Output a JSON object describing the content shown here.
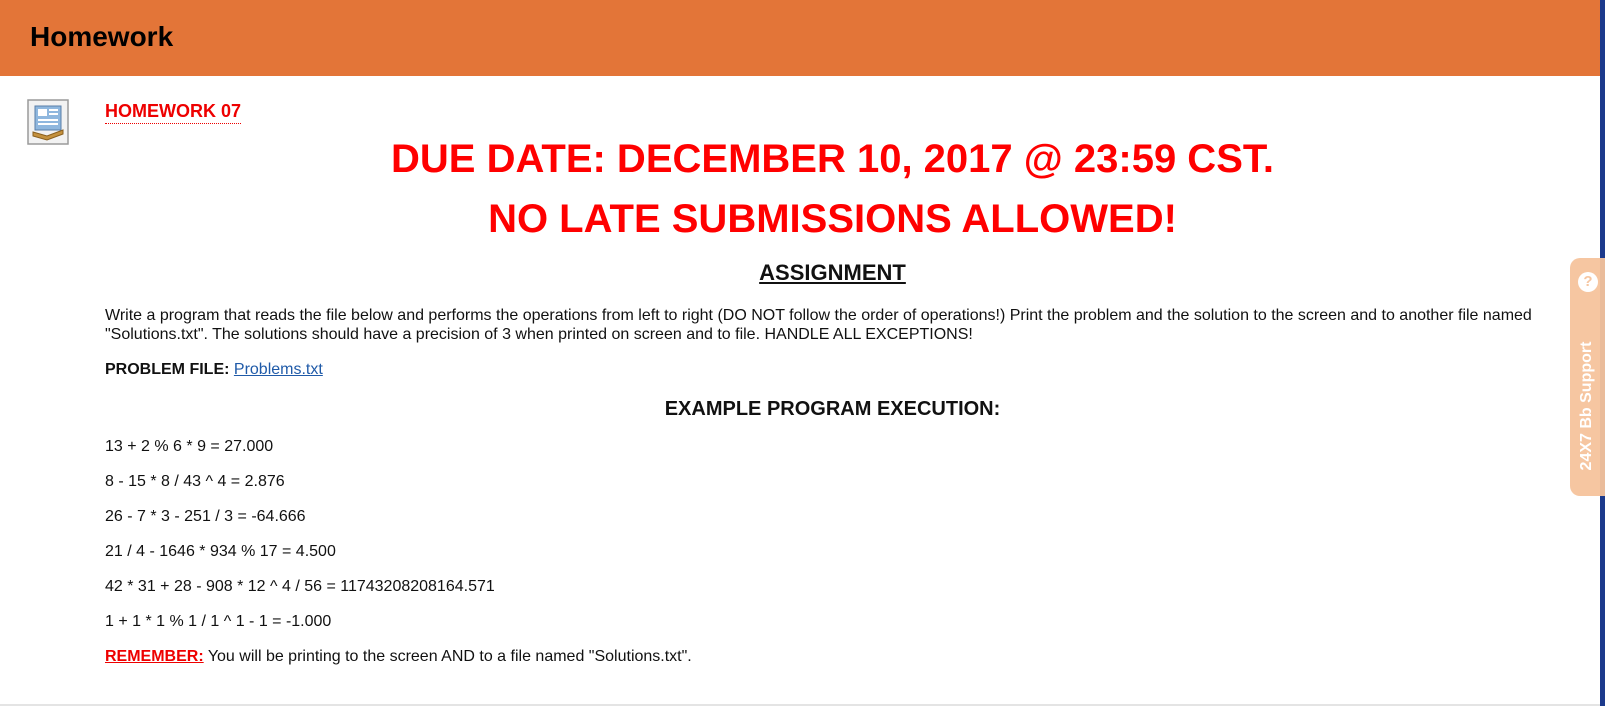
{
  "header": {
    "title": "Homework"
  },
  "item": {
    "link_text": "HOMEWORK 07",
    "icon": "document-assignment-icon"
  },
  "notice": {
    "due_date": "DUE DATE: DECEMBER 10, 2017 @ 23:59 CST.",
    "no_late": "NO LATE SUBMISSIONS ALLOWED!"
  },
  "assignment": {
    "heading": "ASSIGNMENT",
    "description": "Write a program that reads the file below and performs the operations from left to right (DO NOT follow the order of operations!) Print the problem and the solution to the screen and to another file named \"Solutions.txt\". The solutions should have a precision of 3 when printed on screen and to file. HANDLE ALL EXCEPTIONS!",
    "problem_file_label": "PROBLEM FILE:",
    "problem_file_link": "Problems.txt"
  },
  "example": {
    "heading": "EXAMPLE PROGRAM EXECUTION:",
    "lines": [
      "13 + 2 % 6 * 9 = 27.000",
      "8 - 15 * 8 / 43 ^ 4 = 2.876",
      "26 - 7 * 3 - 251 / 3 = -64.666",
      "21 / 4 - 1646 * 934 % 17 = 4.500",
      "42 * 31 + 28 - 908 * 12 ^ 4 / 56 = 11743208208164.571",
      "1 + 1 * 1 % 1 / 1 ^ 1 - 1 = -1.000"
    ]
  },
  "remember": {
    "label": "REMEMBER:",
    "text": " You will be printing to the screen AND to a file named \"Solutions.txt\"."
  },
  "support_tab": {
    "label": "24X7 Bb Support",
    "icon": "help-question-icon"
  },
  "colors": {
    "header_bg": "#e37538",
    "alert_red": "#ff0000",
    "link_blue": "#1f5aa8",
    "support_tab": "#f6c49c"
  }
}
